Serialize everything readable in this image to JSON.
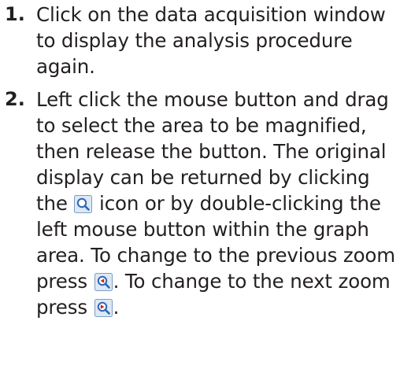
{
  "steps": [
    {
      "number": "1.",
      "text": "Click on the data acquisition window to display the analysis procedure again."
    },
    {
      "number": "2.",
      "text_a": "Left click the mouse button and drag to select the area to be magnified, then release the button. The original display can be returned by clicking the ",
      "icon_a": "magnifier-reset-icon",
      "text_b": " icon or by double-clicking the left mouse button within the graph area. To change to the previous zoom press ",
      "icon_b": "magnifier-previous-zoom-icon",
      "text_c": ". To change to the next zoom press ",
      "icon_c": "magnifier-next-zoom-icon",
      "text_d": "."
    }
  ],
  "colors": {
    "text": "#231f20",
    "icon_border": "#7f9cc0",
    "icon_fill": "#dce8f5",
    "lens": "#2f66b3",
    "arrow": "#c8202b"
  }
}
